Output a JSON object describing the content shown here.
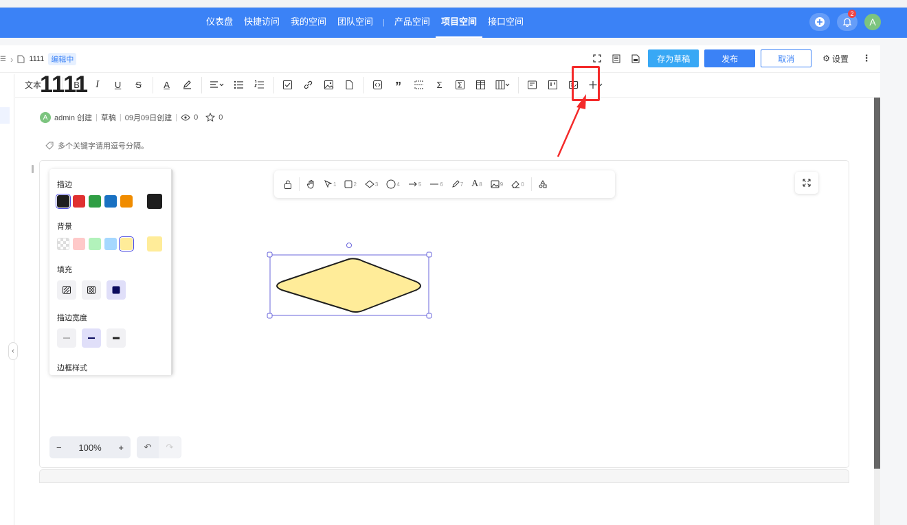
{
  "nav": {
    "items": [
      "仪表盘",
      "快捷访问",
      "我的空间",
      "团队空间",
      "产品空间",
      "项目空间",
      "接口空间"
    ],
    "active": "项目空间",
    "notification_count": "2",
    "avatar_letter": "A"
  },
  "doc": {
    "breadcrumb_name": "1111",
    "status": "编辑中",
    "save_draft": "存为草稿",
    "publish": "发布",
    "cancel": "取消",
    "settings": "设置",
    "title": "1111",
    "author_letter": "A",
    "author": "admin 创建",
    "state": "草稿",
    "created": "09月09日创建",
    "views": "0",
    "stars": "0",
    "tags_placeholder": "多个关键字请用逗号分隔。"
  },
  "toolbar": {
    "text_style": "文本"
  },
  "whiteboard": {
    "shape_numbers": [
      "1",
      "2",
      "3",
      "4",
      "5",
      "6",
      "7",
      "8",
      "9",
      "0"
    ],
    "zoom": "100%"
  },
  "props": {
    "stroke_label": "描边",
    "stroke_colors": [
      "#1e1e1e",
      "#e03131",
      "#2f9e44",
      "#1971c2",
      "#f08c00"
    ],
    "stroke_current": "#1e1e1e",
    "bg_label": "背景",
    "bg_colors": [
      "transparent",
      "#ffc9c9",
      "#b2f2bb",
      "#a5d8ff",
      "#ffec99"
    ],
    "bg_current": "#ffec99",
    "fill_label": "填充",
    "stroke_width_label": "描边宽度",
    "border_style_label": "边框样式"
  },
  "colors": {
    "primary": "#3b82f6",
    "draft_btn": "#38a8f5",
    "highlight": "#f42a2a",
    "selection": "#6965db",
    "diamond_fill": "#ffec99"
  }
}
